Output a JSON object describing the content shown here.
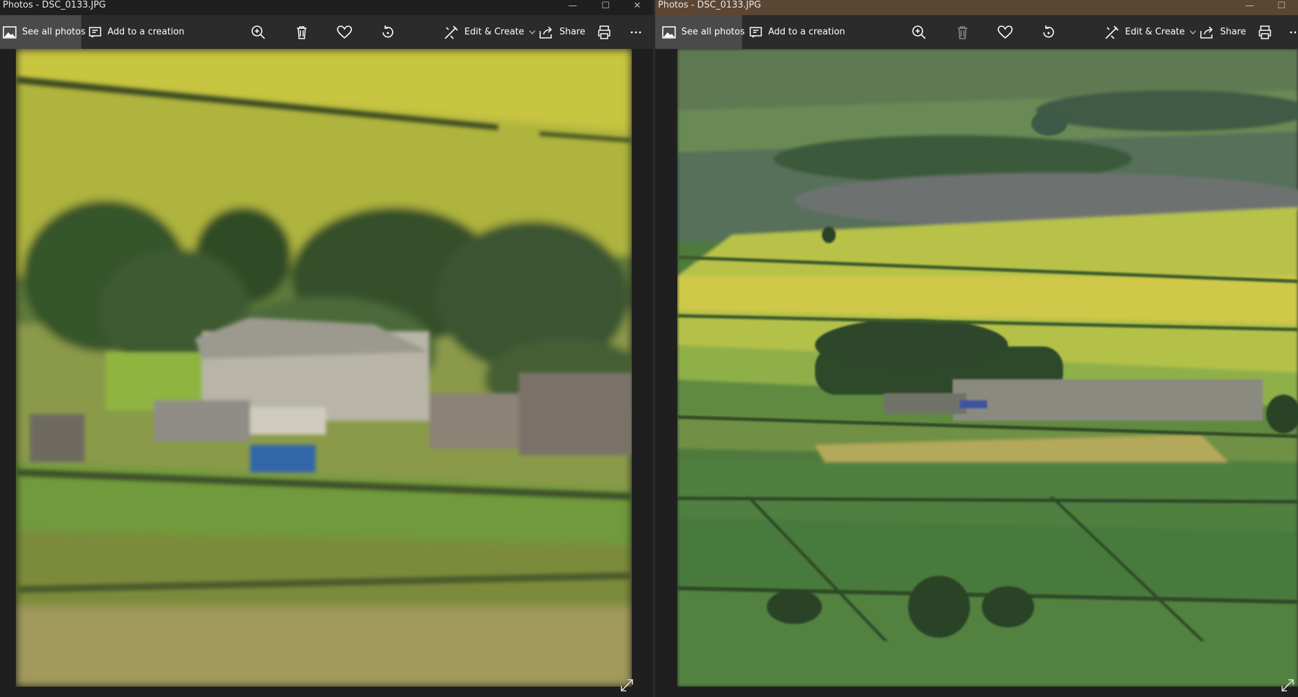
{
  "windows": [
    {
      "title": "Photos - DSC_0133.JPG",
      "toolbar": {
        "see_all": "See all photos",
        "add_creation": "Add to a creation",
        "edit_create": "Edit & Create",
        "share": "Share"
      },
      "icons": {
        "zoom": "zoom-in-icon",
        "delete": "trash-icon",
        "favorite": "heart-icon",
        "rotate": "rotate-icon",
        "print": "printer-icon",
        "more": "more-icon"
      },
      "photo": "zoomed aerial countryside — houses among trees and green fields"
    },
    {
      "title": "Photos - DSC_0133.JPG",
      "toolbar": {
        "see_all": "See all photos",
        "add_creation": "Add to a creation",
        "edit_create": "Edit & Create",
        "share": "Share"
      },
      "icons": {
        "zoom": "zoom-in-icon",
        "delete": "trash-icon",
        "favorite": "heart-icon",
        "rotate": "rotate-icon",
        "print": "printer-icon",
        "more": "more-icon"
      },
      "photo": "wide valley landscape — yellow and green field patchwork, village and trees"
    }
  ],
  "colors": {
    "titlebar_right": "#5a4633",
    "toolbar_bg": "#2b2b2b",
    "active_button_bg": "#4a4a4a"
  }
}
